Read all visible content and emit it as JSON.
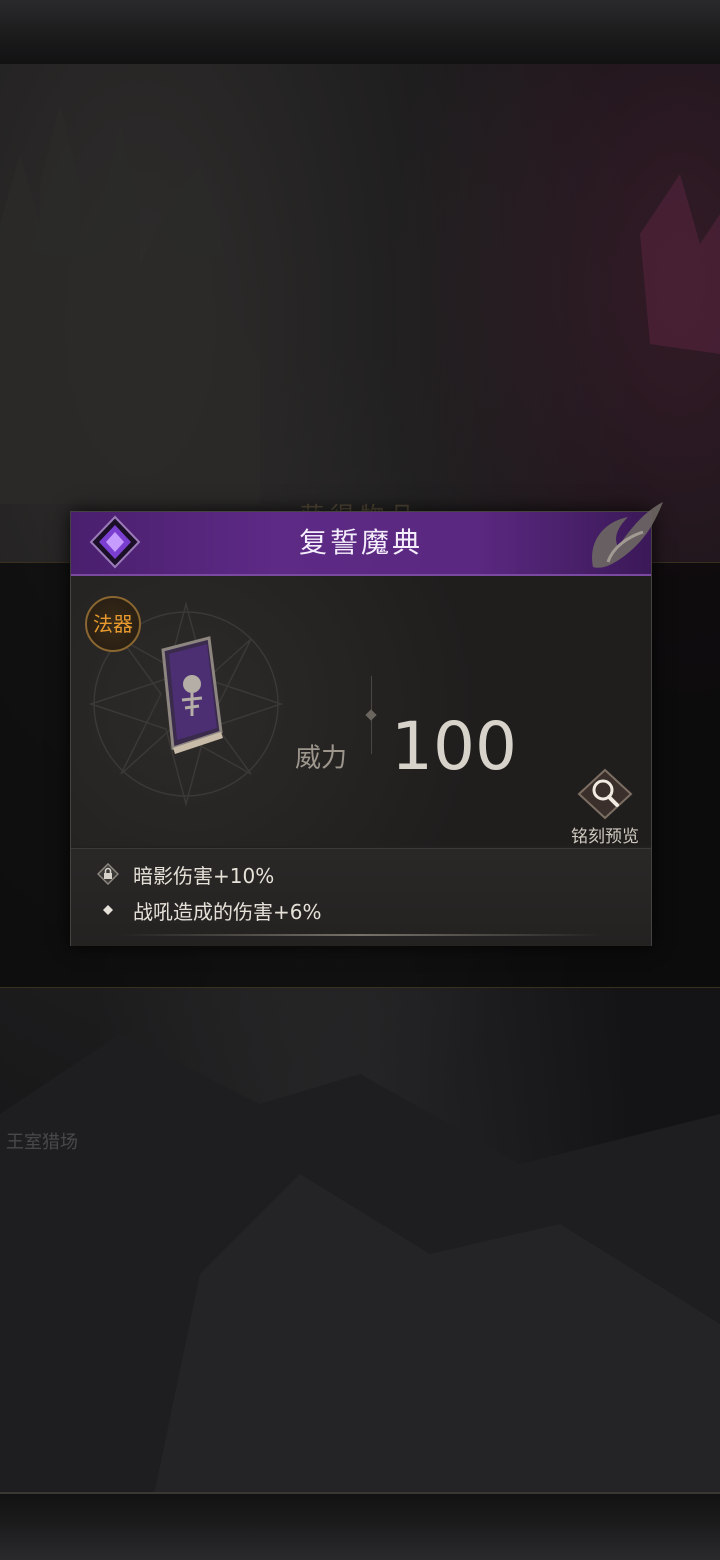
{
  "background": {
    "title": "获得物品",
    "location_label": "王室猎场"
  },
  "item": {
    "name": "复誓魔典",
    "type_badge": "法器",
    "stat": {
      "label": "威力",
      "value": "100"
    },
    "preview_label": "铭刻预览",
    "effects": [
      {
        "text": "暗影伤害+10%",
        "icon": "lock-icon"
      },
      {
        "text": "战吼造成的伤害+6%",
        "icon": "diamond-bullet-icon"
      }
    ]
  },
  "colors": {
    "header": "#5d2a85",
    "badge": "#e89a2e",
    "card_bg": "#222120"
  }
}
